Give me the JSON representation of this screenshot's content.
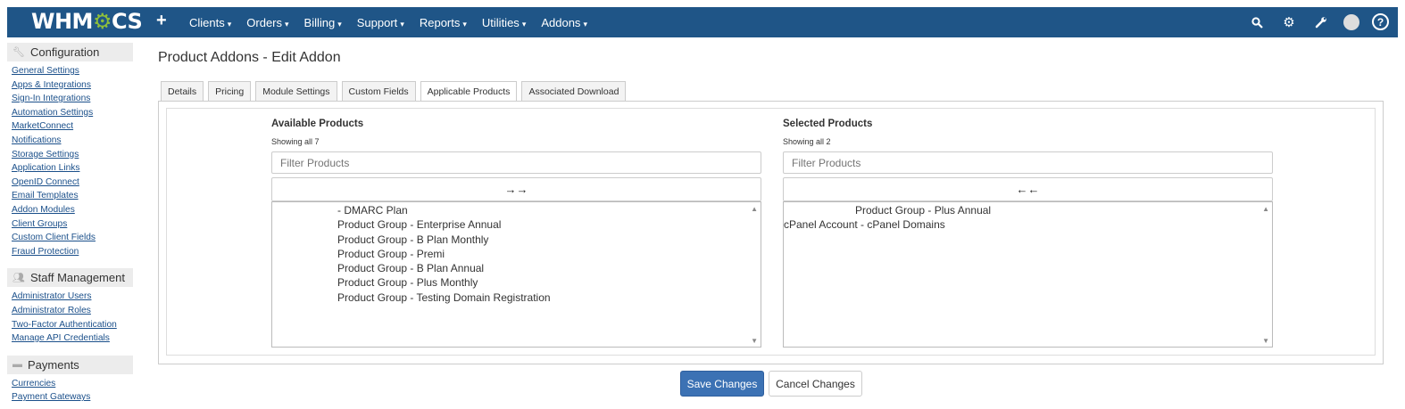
{
  "app": {
    "logo_text_a": "WHM",
    "logo_text_b": "CS"
  },
  "nav": {
    "plus": "+",
    "items": [
      {
        "label": "Clients"
      },
      {
        "label": "Orders"
      },
      {
        "label": "Billing"
      },
      {
        "label": "Support"
      },
      {
        "label": "Reports"
      },
      {
        "label": "Utilities"
      },
      {
        "label": "Addons"
      }
    ],
    "icons": [
      "search-icon",
      "settings-icon",
      "wrench-icon",
      "user-avatar-icon",
      "help-icon"
    ]
  },
  "sidebar": {
    "sections": [
      {
        "title": "Configuration",
        "icon": "wrench-icon",
        "links": [
          "General Settings",
          "Apps & Integrations",
          "Sign-In Integrations",
          "Automation Settings",
          "MarketConnect",
          "Notifications",
          "Storage Settings",
          "Application Links",
          "OpenID Connect",
          "Email Templates",
          "Addon Modules",
          "Client Groups",
          "Custom Client Fields",
          "Fraud Protection"
        ]
      },
      {
        "title": "Staff Management",
        "icon": "users-icon",
        "links": [
          "Administrator Users",
          "Administrator Roles",
          "Two-Factor Authentication",
          "Manage API Credentials"
        ]
      },
      {
        "title": "Payments",
        "icon": "money-icon",
        "links": [
          "Currencies",
          "Payment Gateways"
        ]
      }
    ]
  },
  "page": {
    "title": "Product Addons - Edit Addon"
  },
  "tabs": [
    {
      "label": "Details"
    },
    {
      "label": "Pricing"
    },
    {
      "label": "Module Settings"
    },
    {
      "label": "Custom Fields"
    },
    {
      "label": "Applicable Products",
      "active": true
    },
    {
      "label": "Associated Download"
    }
  ],
  "available": {
    "title": "Available Products",
    "showing": "Showing all 7",
    "filter_placeholder": "Filter Products",
    "move_label": "→→",
    "options": [
      " - DMARC Plan",
      "Product Group - Enterprise Annual",
      "Product Group - B Plan Monthly",
      "Product Group - Premi",
      "Product Group - B Plan Annual",
      "Product Group - Plus Monthly",
      "Product Group - Testing Domain Registration"
    ]
  },
  "selected": {
    "title": "Selected Products",
    "showing": "Showing all 2",
    "filter_placeholder": "Filter Products",
    "move_label": "←←",
    "options": [
      "Product Group - Plus Annual",
      "cPanel Account - cPanel Domains"
    ]
  },
  "actions": {
    "save": "Save Changes",
    "cancel": "Cancel Changes"
  },
  "colors": {
    "nav_bg": "#1f5587",
    "primary_btn": "#3c72b4",
    "link": "#1a4f8a"
  }
}
